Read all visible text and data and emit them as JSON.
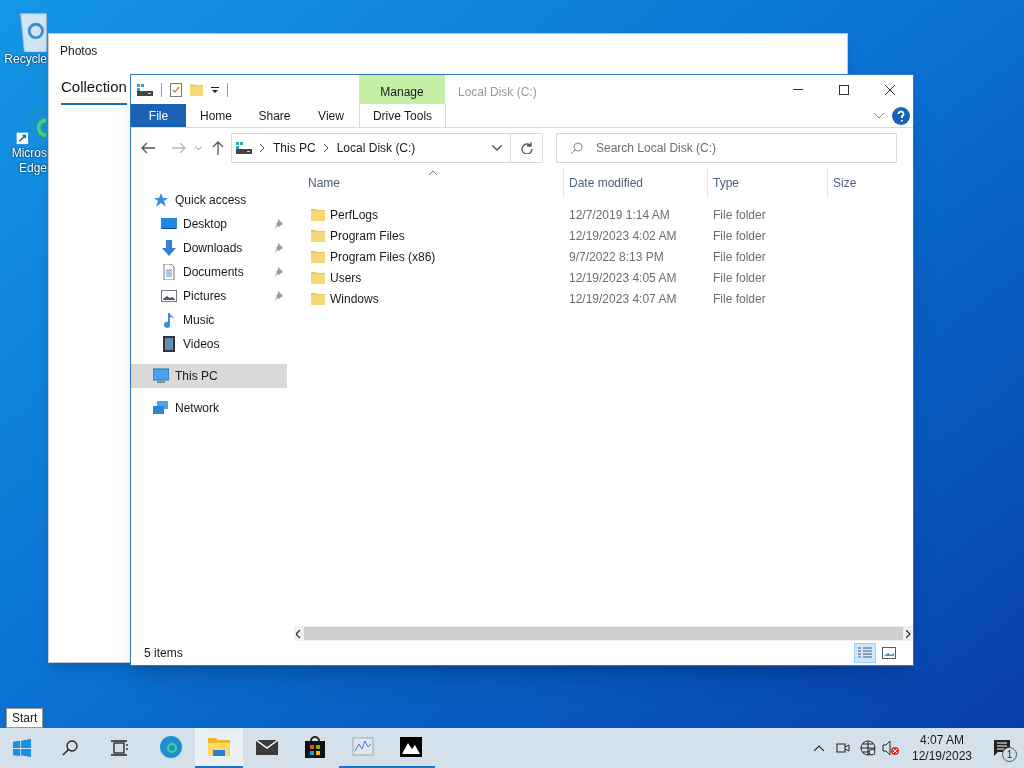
{
  "desktop_icons": [
    {
      "kind": "recycle-bin",
      "label_lines": [
        "Recycle"
      ]
    },
    {
      "kind": "edge",
      "label_lines": [
        "Micros",
        "Edge"
      ]
    }
  ],
  "photos_window": {
    "title": "Photos",
    "tabs": [
      {
        "label": "Collection",
        "selected": true
      }
    ]
  },
  "explorer": {
    "title": "Local Disk (C:)",
    "context_group": "Manage",
    "ribbon_tabs": [
      {
        "label": "File",
        "kind": "file",
        "selected": false
      },
      {
        "label": "Home",
        "kind": "plain",
        "selected": false
      },
      {
        "label": "Share",
        "kind": "plain",
        "selected": false
      },
      {
        "label": "View",
        "kind": "plain",
        "selected": false
      },
      {
        "label": "Drive Tools",
        "kind": "context",
        "selected": false
      }
    ],
    "breadcrumb": [
      "This PC",
      "Local Disk (C:)"
    ],
    "search": {
      "placeholder": "Search Local Disk (C:)"
    },
    "nav": [
      {
        "label": "Quick access",
        "kind": "star",
        "pinned": false,
        "selected": false,
        "children": [
          {
            "label": "Desktop",
            "kind": "desktop",
            "pinned": true,
            "selected": false
          },
          {
            "label": "Downloads",
            "kind": "downloads",
            "pinned": true,
            "selected": false
          },
          {
            "label": "Documents",
            "kind": "documents",
            "pinned": true,
            "selected": false
          },
          {
            "label": "Pictures",
            "kind": "pictures",
            "pinned": true,
            "selected": false
          },
          {
            "label": "Music",
            "kind": "music",
            "pinned": false,
            "selected": false
          },
          {
            "label": "Videos",
            "kind": "videos",
            "pinned": false,
            "selected": false
          }
        ]
      },
      {
        "label": "This PC",
        "kind": "pc",
        "pinned": false,
        "selected": true
      },
      {
        "label": "Network",
        "kind": "network",
        "pinned": false,
        "selected": false
      }
    ],
    "columns": [
      "Name",
      "Date modified",
      "Type",
      "Size"
    ],
    "rows": [
      {
        "name": "PerfLogs",
        "date": "12/7/2019 1:14 AM",
        "type": "File folder"
      },
      {
        "name": "Program Files",
        "date": "12/19/2023 4:02 AM",
        "type": "File folder"
      },
      {
        "name": "Program Files (x86)",
        "date": "9/7/2022 8:13 PM",
        "type": "File folder"
      },
      {
        "name": "Users",
        "date": "12/19/2023 4:05 AM",
        "type": "File folder"
      },
      {
        "name": "Windows",
        "date": "12/19/2023 4:07 AM",
        "type": "File folder"
      }
    ],
    "status": "5 items",
    "view_buttons": [
      {
        "kind": "details",
        "selected": true
      },
      {
        "kind": "tiles",
        "selected": false
      }
    ]
  },
  "tooltip": "Start",
  "taskbar": {
    "apps": [
      {
        "kind": "edge",
        "running": false,
        "active": false
      },
      {
        "kind": "explorer",
        "running": true,
        "active": true
      },
      {
        "kind": "mail",
        "running": false,
        "active": false
      },
      {
        "kind": "store",
        "running": false,
        "active": false
      },
      {
        "kind": "monitor",
        "running": true,
        "active": false
      },
      {
        "kind": "photos",
        "running": true,
        "active": false
      }
    ],
    "clock": {
      "time": "4:07 AM",
      "date": "12/19/2023"
    },
    "notification_count": "1"
  }
}
